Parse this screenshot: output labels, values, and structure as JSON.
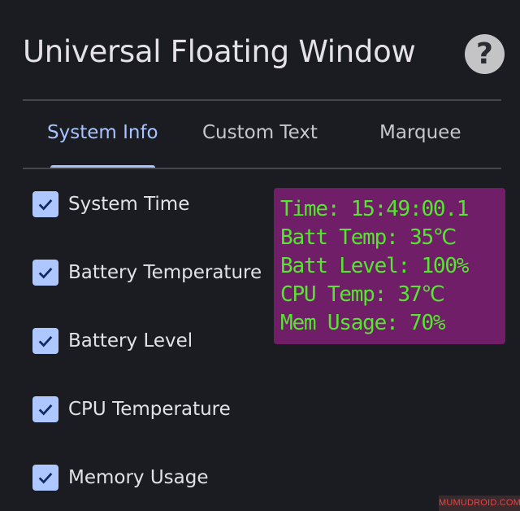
{
  "header": {
    "title": "Universal Floating Window",
    "help_icon": "question-mark-icon",
    "help_glyph": "?"
  },
  "tabs": [
    {
      "label": "System Info",
      "active": true
    },
    {
      "label": "Custom Text",
      "active": false
    },
    {
      "label": "Marquee",
      "active": false
    }
  ],
  "options": [
    {
      "label": "System Time",
      "checked": true
    },
    {
      "label": "Battery Temperature",
      "checked": true
    },
    {
      "label": "Battery Level",
      "checked": true
    },
    {
      "label": "CPU Temperature",
      "checked": true
    },
    {
      "label": "Memory Usage",
      "checked": true
    }
  ],
  "overlay": {
    "lines": [
      "Time: 15:49:00.1",
      "Batt Temp: 35℃",
      "Batt Level: 100%",
      "CPU Temp: 37℃",
      "Mem Usage: 70%"
    ]
  },
  "watermark": "MUMUDROID.COM",
  "colors": {
    "background": "#1b1c21",
    "accent": "#a9c3ff",
    "checkbox": "#aec7ff",
    "overlay_bg": "#6f1e67",
    "overlay_text": "#55e62f"
  }
}
